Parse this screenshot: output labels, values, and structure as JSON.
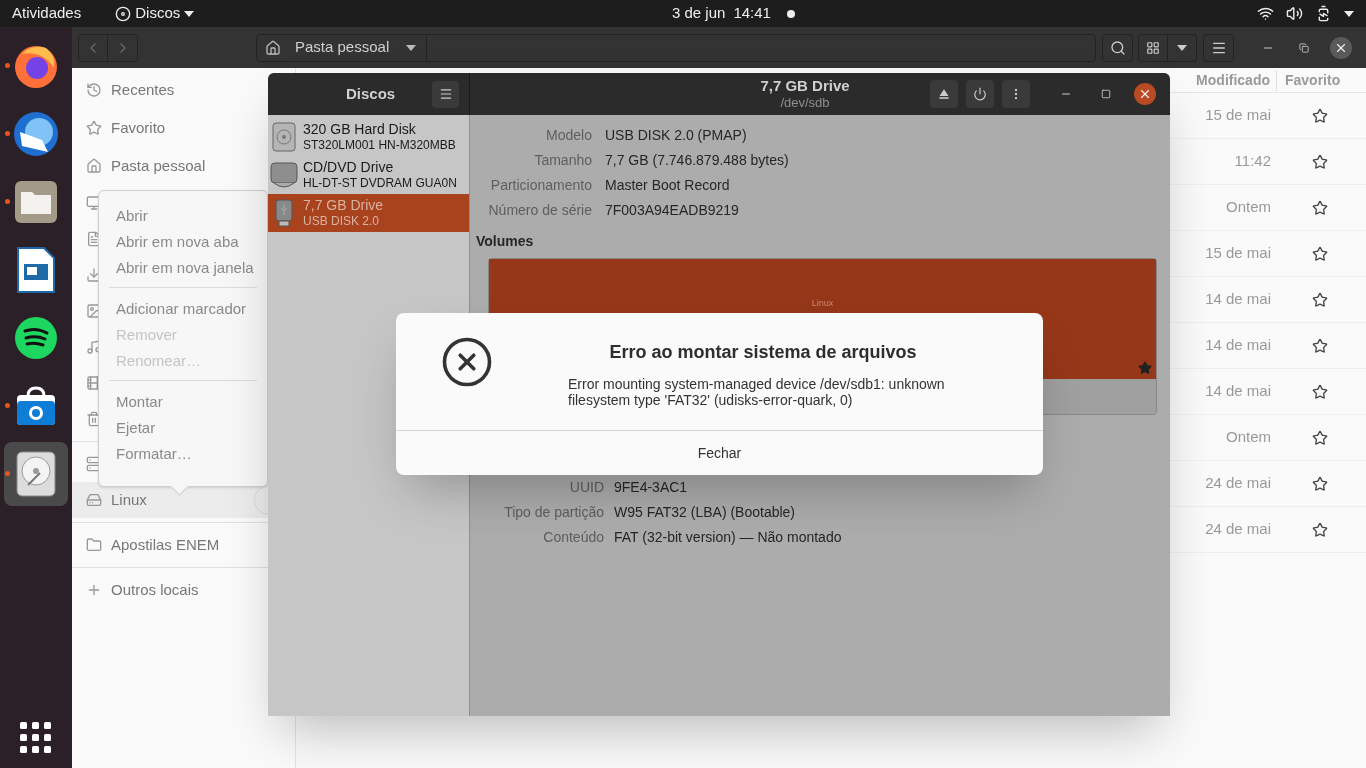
{
  "top_bar": {
    "activities": "Atividades",
    "app_menu": "Discos",
    "date": "3 de jun",
    "time": "14:41"
  },
  "dock": {
    "apps": [
      {
        "kind": "browser",
        "running": true,
        "selected": false
      },
      {
        "kind": "mail",
        "running": true,
        "selected": false
      },
      {
        "kind": "files",
        "running": true,
        "selected": false
      },
      {
        "kind": "presentation",
        "running": false,
        "selected": false
      },
      {
        "kind": "music",
        "running": false,
        "selected": false
      },
      {
        "kind": "store",
        "running": true,
        "selected": false
      },
      {
        "kind": "disks",
        "running": true,
        "selected": true
      }
    ]
  },
  "files_window": {
    "location": "Pasta pessoal",
    "sidebar": [
      [
        {
          "kind": "recent",
          "label": "Recentes",
          "selected": false
        },
        {
          "kind": "starred",
          "label": "Favorito",
          "selected": false
        },
        {
          "kind": "home",
          "label": "Pasta pessoal",
          "selected": false
        },
        {
          "kind": "desktop",
          "selected": false
        },
        {
          "kind": "documents",
          "selected": false
        },
        {
          "kind": "downloads",
          "selected": false
        },
        {
          "kind": "pictures",
          "selected": false
        },
        {
          "kind": "music",
          "selected": false
        },
        {
          "kind": "videos",
          "selected": false
        },
        {
          "kind": "trash",
          "selected": false
        }
      ],
      [
        {
          "kind": "server",
          "selected": false
        },
        {
          "kind": "drive",
          "label": "Linux",
          "selected": true,
          "ejectable": true
        }
      ],
      [
        {
          "kind": "folder",
          "label": "Apostilas ENEM",
          "selected": false
        }
      ],
      [
        {
          "kind": "other",
          "label": "Outros locais",
          "selected": false
        }
      ]
    ],
    "columns": [
      "Modificado",
      "Favorito"
    ],
    "rows": [
      {
        "modified": "15 de mai",
        "starred": false
      },
      {
        "modified": "11:42",
        "starred": false
      },
      {
        "modified": "Ontem",
        "starred": false
      },
      {
        "modified": "15 de mai",
        "starred": false
      },
      {
        "modified": "14 de mai",
        "starred": false
      },
      {
        "modified": "14 de mai",
        "starred": false
      },
      {
        "modified": "14 de mai",
        "starred": false
      },
      {
        "modified": "Ontem",
        "starred": false
      },
      {
        "modified": "24 de mai",
        "starred": false
      },
      {
        "modified": "24 de mai",
        "starred": false
      }
    ]
  },
  "context_menu": {
    "groups": [
      [
        {
          "label": "Abrir",
          "disabled": false
        },
        {
          "label": "Abrir em nova aba",
          "disabled": false
        },
        {
          "label": "Abrir em nova janela",
          "disabled": false
        }
      ],
      [
        {
          "label": "Adicionar marcador",
          "disabled": false
        },
        {
          "label": "Remover",
          "disabled": true
        },
        {
          "label": "Renomear…",
          "disabled": true
        }
      ],
      [
        {
          "label": "Montar",
          "disabled": false
        },
        {
          "label": "Ejetar",
          "disabled": false
        },
        {
          "label": "Formatar…",
          "disabled": false
        }
      ]
    ]
  },
  "disks_window": {
    "title": "Discos",
    "drives": [
      {
        "kind": "hard-disk",
        "name": "320 GB Hard Disk",
        "model": "ST320LM001 HN-M320MBB",
        "selected": false
      },
      {
        "kind": "optical",
        "name": "CD/DVD Drive",
        "model": "HL-DT-ST DVDRAM GUA0N",
        "selected": false
      },
      {
        "kind": "usb",
        "name": "7,7 GB Drive",
        "model": "USB DISK 2.0",
        "selected": true
      }
    ],
    "drive_title": "7,7 GB Drive",
    "drive_path": "/dev/sdb",
    "drive_info": [
      {
        "label": "Modelo",
        "value": "USB DISK 2.0 (PMAP)"
      },
      {
        "label": "Tamanho",
        "value": "7,7 GB (7.746.879.488 bytes)"
      },
      {
        "label": "Particionamento",
        "value": "Master Boot Record"
      },
      {
        "label": "Número de série",
        "value": "7F003A94EADB9219"
      }
    ],
    "volumes_heading": "Volumes",
    "volume_label": "Linux",
    "partition_info": [
      {
        "label": "UUID",
        "value": "9FE4-3AC1"
      },
      {
        "label": "Tipo de partição",
        "value": "W95 FAT32 (LBA) (Bootable)"
      },
      {
        "label": "Conteúdo",
        "value": "FAT (32-bit version) — Não montado"
      }
    ]
  },
  "dialog": {
    "title": "Erro ao montar sistema de arquivos",
    "message": "Error mounting system-managed device /dev/sdb1: unknown filesystem type 'FAT32' (udisks-error-quark, 0)",
    "button": "Fechar"
  }
}
